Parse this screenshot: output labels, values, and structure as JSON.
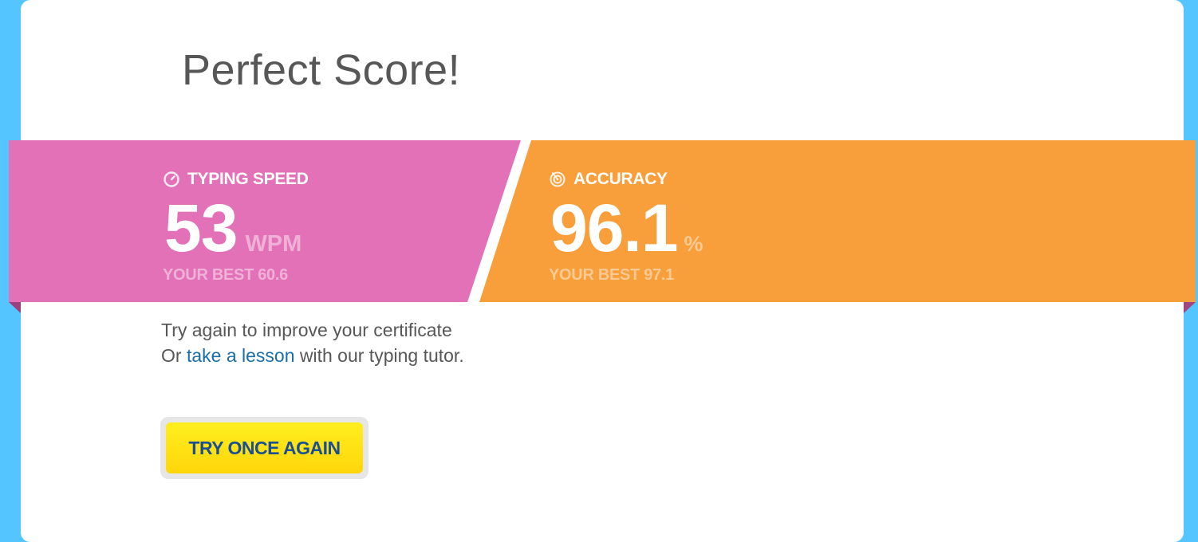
{
  "page": {
    "title": "Perfect Score!"
  },
  "colors": {
    "background": "#55c5ff",
    "card": "#ffffff",
    "speed_panel": "#e371b7",
    "accuracy_panel": "#f89e3a",
    "button": "#ffe31a",
    "button_text": "#1b4f93",
    "link": "#1a6fa8",
    "text": "#575757"
  },
  "results": {
    "speed": {
      "icon": "stopwatch-icon",
      "label": "TYPING SPEED",
      "value": "53",
      "unit": "WPM",
      "best": "YOUR BEST 60.6"
    },
    "accuracy": {
      "icon": "target-icon",
      "label": "ACCURACY",
      "value": "96.1",
      "unit": "%",
      "best": "YOUR BEST 97.1"
    }
  },
  "message": {
    "line1": "Try again to improve your certificate",
    "line2_prefix": "Or ",
    "line2_link": "take a lesson",
    "line2_suffix": " with our typing tutor."
  },
  "actions": {
    "retry_label": "TRY ONCE AGAIN"
  }
}
